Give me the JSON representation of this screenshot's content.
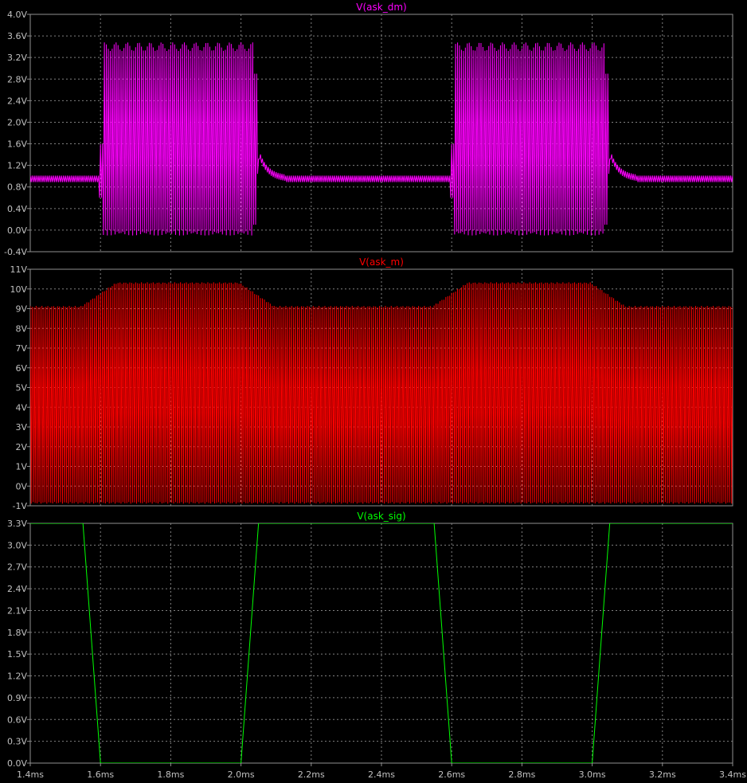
{
  "chart_data": [
    {
      "type": "line",
      "title": "V(ask_dm)",
      "color": "#ff00ff",
      "ylim": [
        -0.4,
        4.0
      ],
      "yticks": [
        -0.4,
        0.0,
        0.4,
        0.8,
        1.2,
        1.6,
        2.0,
        2.4,
        2.8,
        3.2,
        3.6,
        4.0
      ],
      "ytick_labels": [
        "-0.4V",
        "0.0V",
        "0.4V",
        "0.8V",
        "1.2V",
        "1.6V",
        "2.0V",
        "2.4V",
        "2.8V",
        "3.2V",
        "3.6V",
        "4.0V"
      ],
      "signal": {
        "kind": "demodulated_burst",
        "bursts_ms": [
          [
            1.595,
            2.045
          ],
          [
            2.595,
            3.045
          ]
        ],
        "baseline": 0.95,
        "baseline_ripple": 0.06,
        "burst_high": 3.4,
        "burst_low": -0.05,
        "overshoot_peak": 1.55,
        "cycles_per_ms": 180
      }
    },
    {
      "type": "line",
      "title": "V(ask_m)",
      "color": "#ff0000",
      "ylim": [
        -1,
        11
      ],
      "yticks": [
        -1,
        0,
        1,
        2,
        3,
        4,
        5,
        6,
        7,
        8,
        9,
        10,
        11
      ],
      "ytick_labels": [
        "-1V",
        "0V",
        "1V",
        "2V",
        "3V",
        "4V",
        "5V",
        "6V",
        "7V",
        "8V",
        "9V",
        "10V",
        "11V"
      ],
      "signal": {
        "kind": "modulated_carrier",
        "bursts_ms": [
          [
            1.595,
            2.045
          ],
          [
            2.595,
            3.045
          ]
        ],
        "high_level_off": 9.1,
        "high_level_on": 10.3,
        "low_level": -0.85,
        "cycles_per_ms": 180
      }
    },
    {
      "type": "line",
      "title": "V(ask_sig)",
      "color": "#00ff00",
      "ylim": [
        0.0,
        3.3
      ],
      "yticks": [
        0.0,
        0.3,
        0.6,
        0.9,
        1.2,
        1.5,
        1.8,
        2.1,
        2.4,
        2.7,
        3.0,
        3.3
      ],
      "ytick_labels": [
        "0.0V",
        "0.3V",
        "0.6V",
        "0.9V",
        "1.2V",
        "1.5V",
        "1.8V",
        "2.1V",
        "2.4V",
        "2.7V",
        "3.0V",
        "3.3V"
      ],
      "x": [
        1.4,
        1.55,
        1.6,
        2.0,
        2.05,
        2.55,
        2.6,
        3.0,
        3.05,
        3.4
      ],
      "y": [
        3.3,
        3.3,
        0.0,
        0.0,
        3.3,
        3.3,
        0.0,
        0.0,
        3.3,
        3.3
      ]
    }
  ],
  "xaxis": {
    "xlim": [
      1.4,
      3.4
    ],
    "xticks": [
      1.4,
      1.6,
      1.8,
      2.0,
      2.2,
      2.4,
      2.6,
      2.8,
      3.0,
      3.2,
      3.4
    ],
    "xtick_labels": [
      "1.4ms",
      "1.6ms",
      "1.8ms",
      "2.0ms",
      "2.2ms",
      "2.4ms",
      "2.6ms",
      "2.8ms",
      "3.0ms",
      "3.2ms",
      "3.4ms"
    ],
    "grid": true,
    "grid_color": "#808080",
    "axis_color": "#909090",
    "label_color": "#c0c0c0"
  }
}
